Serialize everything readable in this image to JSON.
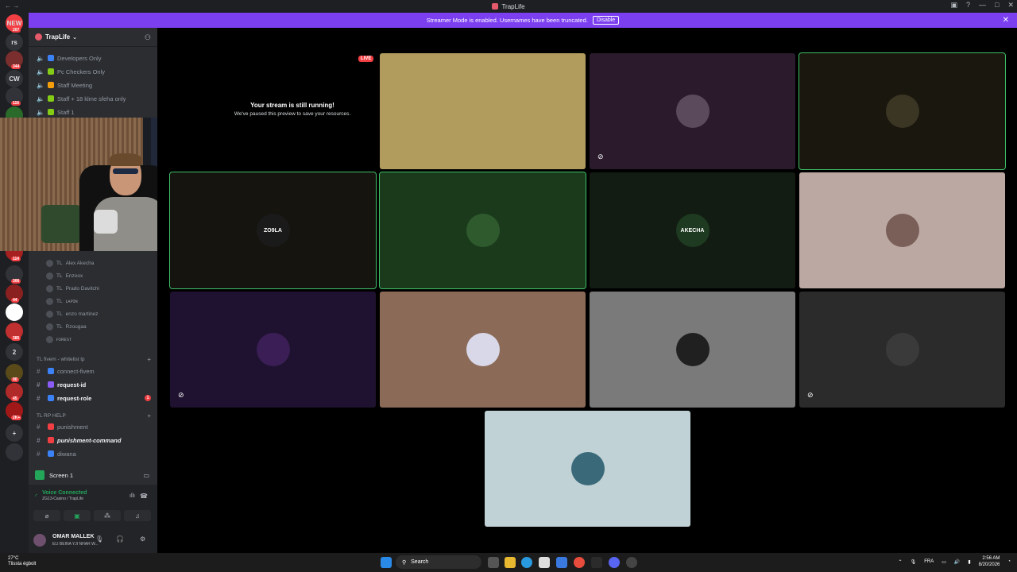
{
  "titlebar": {
    "title": "TrapLife"
  },
  "banner": {
    "text": "Streamer Mode is enabled. Usernames have been truncated.",
    "button": "Disable"
  },
  "guilds": [
    {
      "label": "NEW",
      "badge": "207"
    },
    {
      "label": "rs",
      "badge": ""
    },
    {
      "label": "",
      "badge": "344"
    },
    {
      "label": "CW",
      "badge": ""
    },
    {
      "label": "",
      "badge": "116"
    },
    {
      "label": "",
      "badge": ""
    },
    {
      "label": "",
      "badge": "114"
    },
    {
      "label": "",
      "badge": "306"
    },
    {
      "label": "",
      "badge": "44"
    },
    {
      "label": "",
      "badge": ""
    },
    {
      "label": "",
      "badge": "385"
    },
    {
      "label": "2",
      "badge": ""
    },
    {
      "label": "",
      "badge": "90"
    },
    {
      "label": "",
      "badge": "45"
    },
    {
      "label": "",
      "badge": "2K+"
    },
    {
      "label": "+",
      "badge": ""
    },
    {
      "label": "",
      "badge": ""
    }
  ],
  "server": {
    "name": "TrapLife"
  },
  "channels_top": [
    {
      "name": "Developers Only"
    },
    {
      "name": "Pc Checkers Only"
    },
    {
      "name": "Staff Meeting"
    },
    {
      "name": "Staff + 18 klme sfeha only"
    },
    {
      "name": "Staff 1"
    }
  ],
  "voice_users": [
    {
      "tag": "TL",
      "name": "Alex Akecha"
    },
    {
      "tag": "TL",
      "name": "Enzoox"
    },
    {
      "tag": "TL",
      "name": "Prado Davitchi"
    },
    {
      "tag": "TL",
      "name": "ʟᴀᴘɪɴ"
    },
    {
      "tag": "TL",
      "name": "enzo martinez"
    },
    {
      "tag": "TL",
      "name": "Rzougaa"
    },
    {
      "tag": "",
      "name": "ғᴏʀᴇsᴛ"
    }
  ],
  "category_fivem": {
    "name": "TL fivem - whitelist lp"
  },
  "channels_fivem": [
    {
      "name": "connect-fivem",
      "bold": false,
      "badge": ""
    },
    {
      "name": "request-id",
      "bold": true,
      "badge": ""
    },
    {
      "name": "request-role",
      "bold": true,
      "badge": "1"
    }
  ],
  "category_help": {
    "name": "TL RP HELP"
  },
  "channels_help": [
    {
      "name": "punishment"
    },
    {
      "name": "punishment-command"
    },
    {
      "name": "diwana"
    }
  ],
  "voice_panel": {
    "screen_label": "Screen 1",
    "status": "Voice Connected",
    "location": "ZG13-Casino / TrapLife"
  },
  "user": {
    "name": "OMAR MALLEK",
    "status": "ELI BEINA YJI NHAR W..."
  },
  "stage": {
    "live": "LIVE",
    "paused_title": "Your stream is still running!",
    "paused_sub": "We've paused this preview to save your resources.",
    "tiles": [
      {
        "bg": "#b19b5d",
        "avatar_bg": "#b19b5d",
        "label": "",
        "muted": false,
        "speaking": false
      },
      {
        "bg": "#2a1a2c",
        "avatar_bg": "#5a4a5c",
        "label": "",
        "muted": true,
        "speaking": false
      },
      {
        "bg": "#1a170e",
        "avatar_bg": "#3b3524",
        "label": "",
        "muted": false,
        "speaking": true
      },
      {
        "bg": "#16140f",
        "avatar_bg": "#1a1a1a",
        "label": "ZO9LA",
        "muted": false,
        "speaking": true
      },
      {
        "bg": "#1b3a1b",
        "avatar_bg": "#2e5a2e",
        "label": "",
        "muted": false,
        "speaking": true
      },
      {
        "bg": "#121c12",
        "avatar_bg": "#1e3a20",
        "label": "AKECHA",
        "muted": false,
        "speaking": false
      },
      {
        "bg": "#bca8a2",
        "avatar_bg": "#7a5e58",
        "label": "",
        "muted": false,
        "speaking": false
      },
      {
        "bg": "#1f1230",
        "avatar_bg": "#3a1e55",
        "label": "",
        "muted": true,
        "speaking": false
      },
      {
        "bg": "#8c6a58",
        "avatar_bg": "#d8d8e8",
        "label": "",
        "muted": false,
        "speaking": false
      },
      {
        "bg": "#7a7a7a",
        "avatar_bg": "#202020",
        "label": "",
        "muted": false,
        "speaking": false
      },
      {
        "bg": "#2b2b2b",
        "avatar_bg": "#3a3a3a",
        "label": "",
        "muted": true,
        "speaking": false
      },
      {
        "bg": "#c0d2d6",
        "avatar_bg": "#3a6a7a",
        "label": "",
        "muted": false,
        "speaking": false
      }
    ]
  },
  "taskbar": {
    "temp": "27°C",
    "weather": "Tlissta égbolt",
    "search": "Search",
    "lang": "FRA",
    "time": "2:56 AM",
    "date": "8/20/2026"
  }
}
